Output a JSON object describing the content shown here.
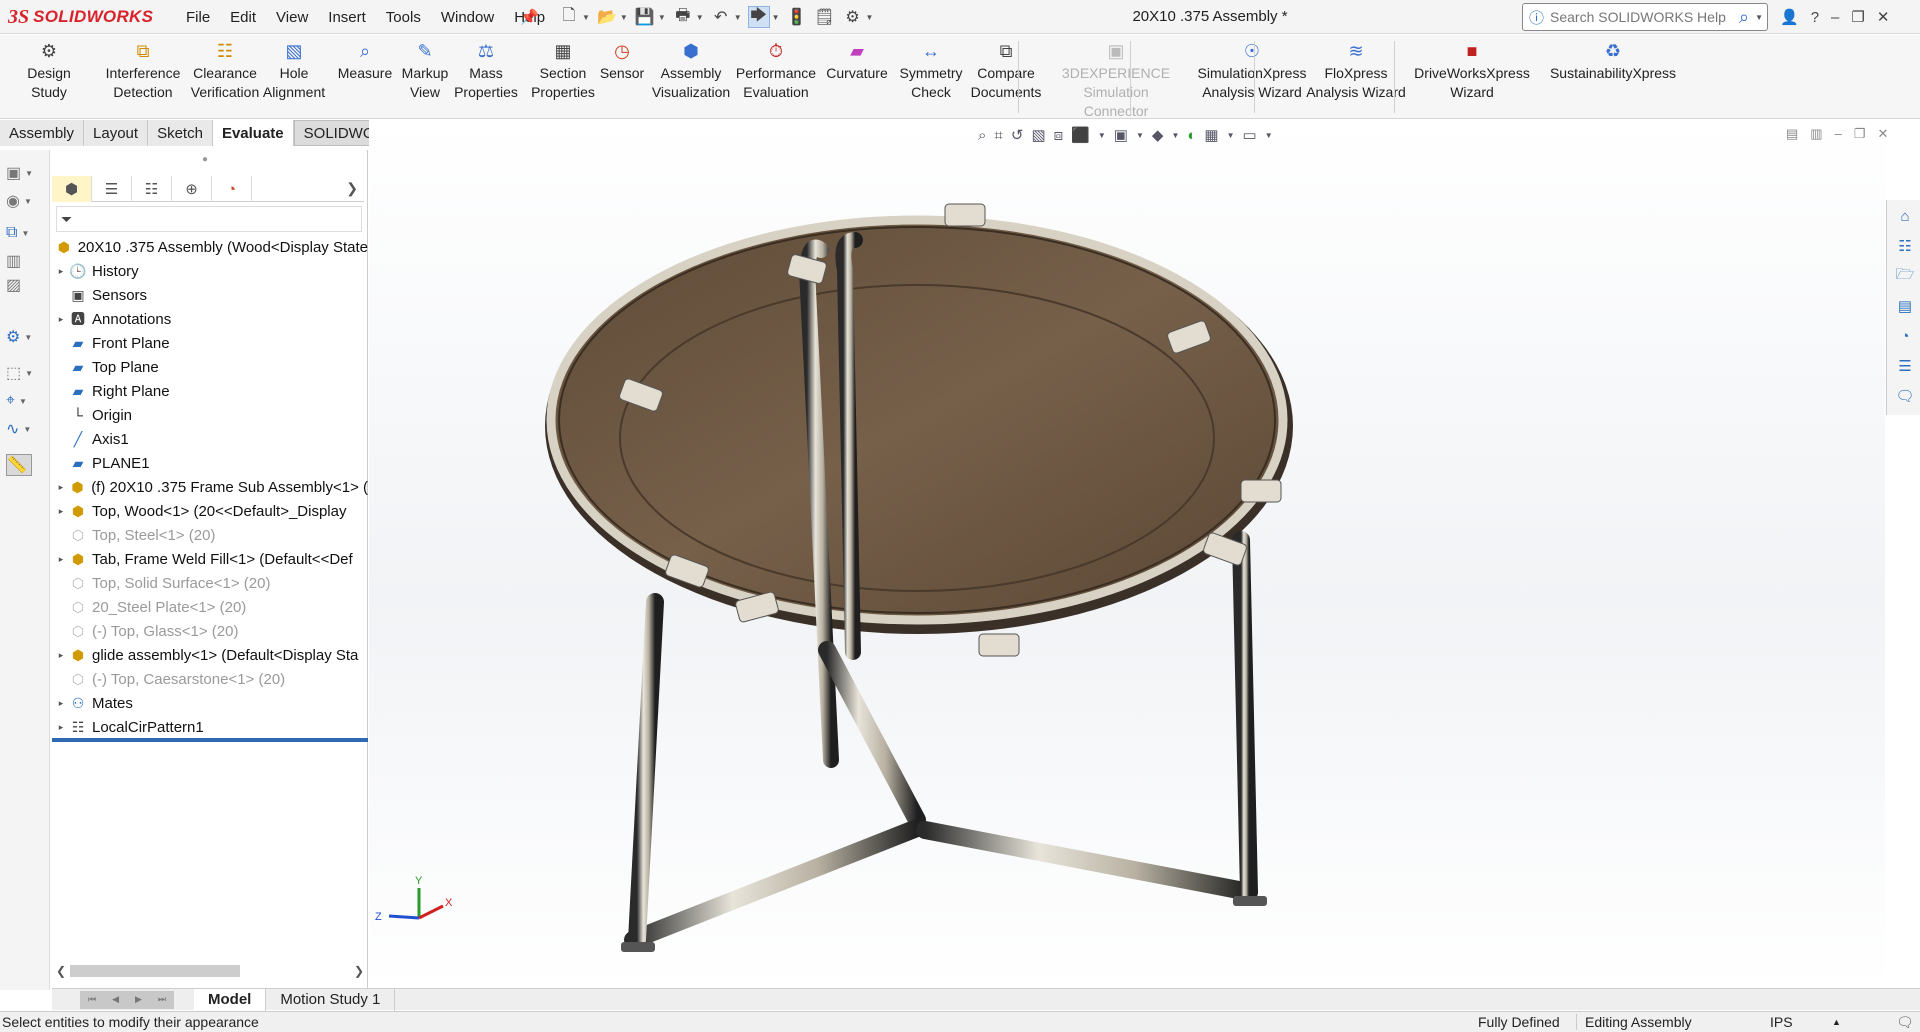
{
  "app": {
    "brand_ds": "3S",
    "brand_name": "SOLIDWORKS",
    "document_title": "20X10 .375 Assembly *"
  },
  "menu": [
    "File",
    "Edit",
    "View",
    "Insert",
    "Tools",
    "Window",
    "Help"
  ],
  "search": {
    "placeholder": "Search SOLIDWORKS Help"
  },
  "commands": [
    {
      "label": "Design Study",
      "icon": "design-study-icon"
    },
    {
      "label": "Interference Detection",
      "icon": "interference-icon"
    },
    {
      "label": "Clearance Verification",
      "icon": "clearance-icon"
    },
    {
      "label": "Hole Alignment",
      "icon": "hole-alignment-icon"
    },
    {
      "label": "Measure",
      "icon": "measure-icon"
    },
    {
      "label": "Markup View",
      "icon": "markup-icon"
    },
    {
      "label": "Mass Properties",
      "icon": "mass-properties-icon"
    },
    {
      "label": "Section Properties",
      "icon": "section-properties-icon"
    },
    {
      "label": "Sensor",
      "icon": "sensor-icon"
    },
    {
      "label": "Assembly Visualization",
      "icon": "assembly-visualization-icon"
    },
    {
      "label": "Performance Evaluation",
      "icon": "performance-icon"
    },
    {
      "label": "Curvature",
      "icon": "curvature-icon"
    },
    {
      "label": "Symmetry Check",
      "icon": "symmetry-icon"
    },
    {
      "label": "Compare Documents",
      "icon": "compare-icon"
    },
    {
      "label": "3DEXPERIENCE Simulation Connector",
      "icon": "3dx-icon",
      "disabled": true
    },
    {
      "label": "SimulationXpress Analysis Wizard",
      "icon": "simulationxpress-icon"
    },
    {
      "label": "FloXpress Analysis Wizard",
      "icon": "floxpress-icon"
    },
    {
      "label": "DriveWorksXpress Wizard",
      "icon": "driveworks-icon"
    },
    {
      "label": "SustainabilityXpress",
      "icon": "sustainability-icon"
    }
  ],
  "tabs": [
    {
      "label": "Assembly"
    },
    {
      "label": "Layout"
    },
    {
      "label": "Sketch"
    },
    {
      "label": "Evaluate",
      "active": true
    },
    {
      "label": "SOLIDWORKS Add-Ins"
    }
  ],
  "tree": [
    {
      "label": "20X10 .375 Assembly  (Wood<Display State",
      "icon": "assembly-icon",
      "expander": false
    },
    {
      "label": "History",
      "icon": "history-icon",
      "expander": true
    },
    {
      "label": "Sensors",
      "icon": "sensors-icon",
      "expander": false
    },
    {
      "label": "Annotations",
      "icon": "annotations-icon",
      "expander": true
    },
    {
      "label": "Front Plane",
      "icon": "plane-icon",
      "expander": false
    },
    {
      "label": "Top Plane",
      "icon": "plane-icon",
      "expander": false
    },
    {
      "label": "Right Plane",
      "icon": "plane-icon",
      "expander": false
    },
    {
      "label": "Origin",
      "icon": "origin-icon",
      "expander": false
    },
    {
      "label": "Axis1",
      "icon": "axis-icon",
      "expander": false
    },
    {
      "label": "PLANE1",
      "icon": "plane-icon",
      "expander": false
    },
    {
      "label": "(f) 20X10 .375 Frame Sub Assembly<1> (",
      "icon": "subassembly-icon",
      "expander": true
    },
    {
      "label": "Top, Wood<1> (20<<Default>_Display",
      "icon": "part-icon",
      "expander": true
    },
    {
      "label": "Top, Steel<1> (20)",
      "icon": "part-suppressed-icon",
      "expander": false,
      "suppressed": true
    },
    {
      "label": "Tab, Frame Weld Fill<1> (Default<<Def",
      "icon": "part-icon",
      "expander": true
    },
    {
      "label": "Top, Solid Surface<1> (20)",
      "icon": "part-suppressed-icon",
      "expander": false,
      "suppressed": true
    },
    {
      "label": "20_Steel Plate<1> (20)",
      "icon": "part-suppressed-icon",
      "expander": false,
      "suppressed": true
    },
    {
      "label": "(-) Top, Glass<1> (20)",
      "icon": "part-suppressed-icon",
      "expander": false,
      "suppressed": true
    },
    {
      "label": "glide assembly<1> (Default<Display Sta",
      "icon": "subassembly-icon",
      "expander": true
    },
    {
      "label": "(-) Top, Caesarstone<1> (20)",
      "icon": "part-suppressed-icon",
      "expander": false,
      "suppressed": true
    },
    {
      "label": "Mates",
      "icon": "mates-icon",
      "expander": true
    },
    {
      "label": "LocalCirPattern1",
      "icon": "pattern-icon",
      "expander": true
    }
  ],
  "model_tabs": [
    {
      "label": "Model",
      "active": true
    },
    {
      "label": "Motion Study 1"
    }
  ],
  "status": {
    "message": "Select entities to modify their appearance",
    "defined": "Fully Defined",
    "mode": "Editing Assembly",
    "units": "IPS"
  },
  "colors": {
    "accent": "#2e6ab1",
    "brand": "#d8232a",
    "wood": "#6b5540",
    "steel": "#c9c3b6"
  }
}
